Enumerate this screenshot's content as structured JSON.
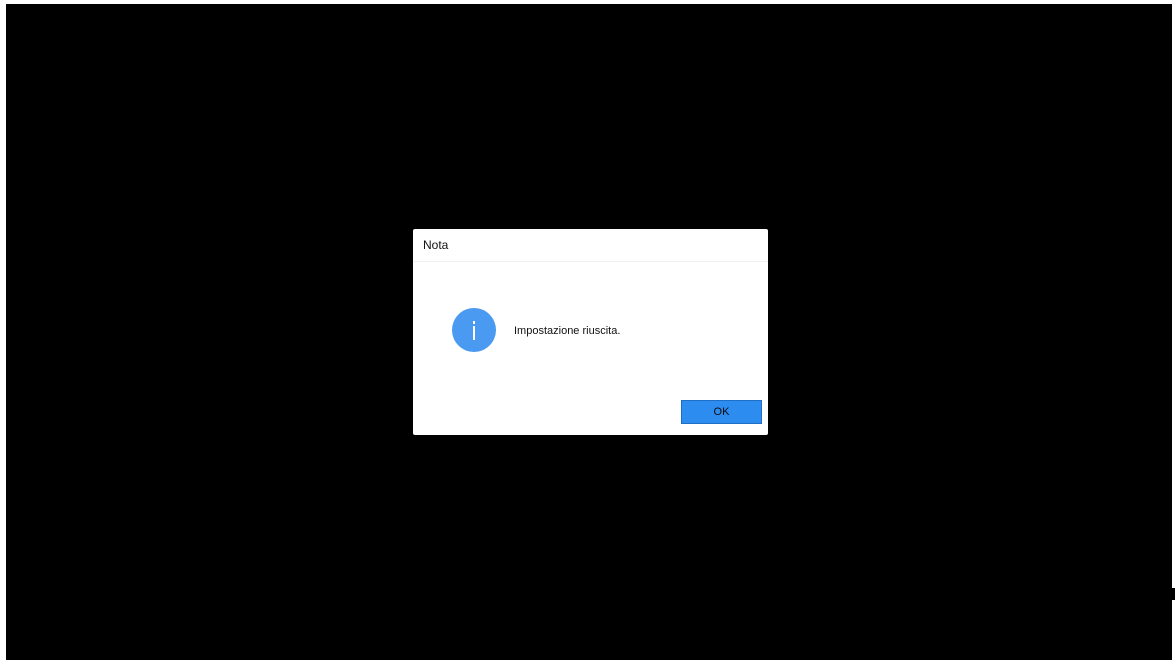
{
  "dialog": {
    "title": "Nota",
    "message": "Impostazione riuscita.",
    "icon": "info-icon",
    "ok_label": "OK"
  },
  "colors": {
    "background": "#000000",
    "dialog": "#ffffff",
    "accent": "#2d8cf0",
    "icon": "#4a9af2"
  }
}
